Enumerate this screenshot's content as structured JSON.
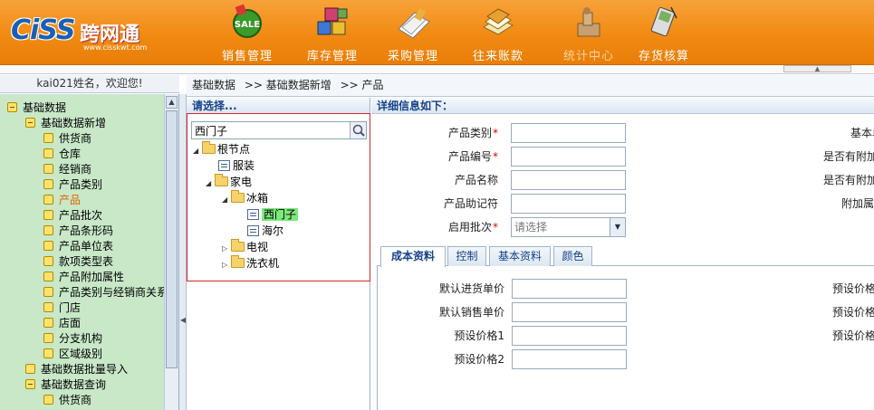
{
  "app": {
    "logo_text": "CiSS",
    "logo_cn": "跨网通",
    "logo_url": "www.cisskwt.com"
  },
  "nav": [
    {
      "label": "销售管理",
      "icon": "sale-icon"
    },
    {
      "label": "库存管理",
      "icon": "blocks-icon"
    },
    {
      "label": "采购管理",
      "icon": "papers-icon"
    },
    {
      "label": "往来账款",
      "icon": "ledger-icon"
    },
    {
      "label": "统计中心",
      "icon": "stats-icon"
    },
    {
      "label": "存货核算",
      "icon": "pda-icon"
    }
  ],
  "welcome": "kai021姓名，欢迎您!",
  "sidebar": {
    "items": [
      {
        "label": "基础数据",
        "level": 0,
        "expanded": true
      },
      {
        "label": "基础数据新增",
        "level": 1,
        "expanded": true
      },
      {
        "label": "供货商",
        "level": 2
      },
      {
        "label": "仓库",
        "level": 2
      },
      {
        "label": "经销商",
        "level": 2
      },
      {
        "label": "产品类别",
        "level": 2
      },
      {
        "label": "产品",
        "level": 2,
        "selected": true
      },
      {
        "label": "产品批次",
        "level": 2
      },
      {
        "label": "产品条形码",
        "level": 2
      },
      {
        "label": "产品单位表",
        "level": 2
      },
      {
        "label": "款项类型表",
        "level": 2
      },
      {
        "label": "产品附加属性",
        "level": 2
      },
      {
        "label": "产品类别与经销商关系",
        "level": 2
      },
      {
        "label": "门店",
        "level": 2
      },
      {
        "label": "店面",
        "level": 2
      },
      {
        "label": "分支机构",
        "level": 2
      },
      {
        "label": "区域级别",
        "level": 2
      },
      {
        "label": "基础数据批量导入",
        "level": 1
      },
      {
        "label": "基础数据查询",
        "level": 1,
        "expanded": true
      },
      {
        "label": "供货商",
        "level": 2
      }
    ]
  },
  "breadcrumb": [
    "基础数据",
    ">> 基础数据新增",
    ">> 产品"
  ],
  "picker": {
    "title": "请选择...",
    "search_value": "西门子",
    "tree": [
      {
        "label": "根节点",
        "depth": 0,
        "kind": "folder",
        "open": true
      },
      {
        "label": "服装",
        "depth": 1,
        "kind": "leaf"
      },
      {
        "label": "家电",
        "depth": 1,
        "kind": "folder",
        "open": true
      },
      {
        "label": "冰箱",
        "depth": 2,
        "kind": "folder",
        "open": true
      },
      {
        "label": "西门子",
        "depth": 3,
        "kind": "leaf",
        "highlight": true
      },
      {
        "label": "海尔",
        "depth": 3,
        "kind": "leaf"
      },
      {
        "label": "电视",
        "depth": 2,
        "kind": "folder",
        "open": false
      },
      {
        "label": "洗衣机",
        "depth": 2,
        "kind": "folder",
        "open": false
      }
    ]
  },
  "detail": {
    "title": "详细信息如下：",
    "fields": [
      {
        "label": "产品类别",
        "required": true
      },
      {
        "label": "产品编号",
        "required": true
      },
      {
        "label": "产品名称",
        "required": false
      },
      {
        "label": "产品助记符",
        "required": false
      },
      {
        "label": "启用批次",
        "required": true,
        "select": true,
        "placeholder": "请选择"
      }
    ],
    "right_labels": [
      "基本单位",
      "是否有附加属性",
      "是否有附加属性",
      "附加属性组"
    ],
    "tabs": [
      "成本资料",
      "控制",
      "基本资料",
      "颜色"
    ],
    "tab_fields": [
      "默认进货单价",
      "默认销售单价",
      "预设价格1",
      "预设价格2"
    ],
    "tab_right_labels": [
      "预设价格",
      "预设价格",
      "预设价格"
    ]
  }
}
